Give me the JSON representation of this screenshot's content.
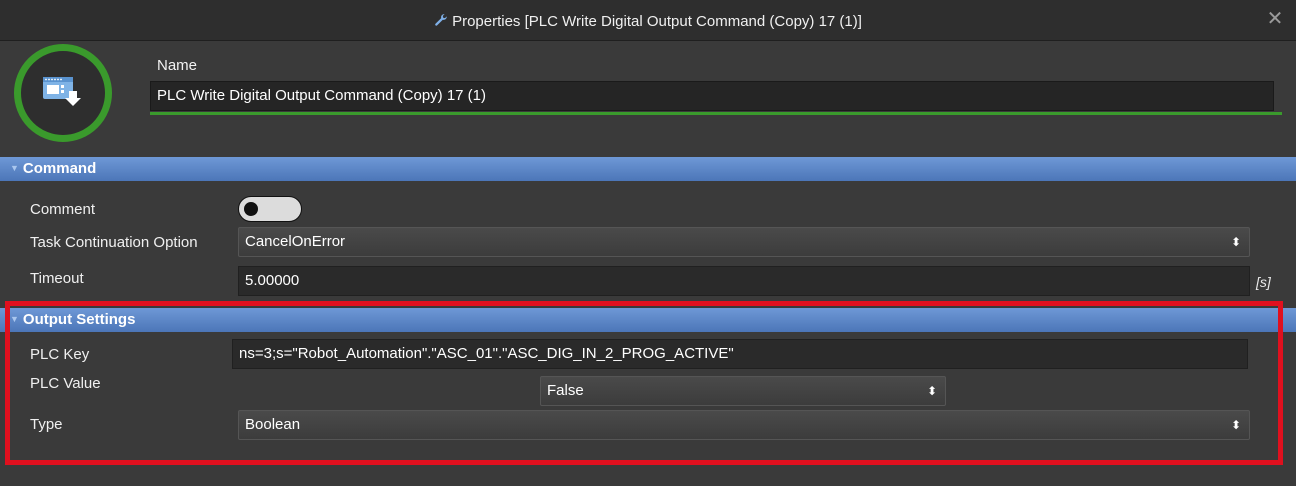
{
  "window": {
    "title": "Properties [PLC Write Digital Output Command (Copy) 17 (1)]",
    "title_icon": "wrench-icon",
    "close_icon": "close-icon"
  },
  "header": {
    "icon": "plc-output-icon",
    "icon_ring_color": "#3a9a2c",
    "name_label": "Name",
    "name_value": "PLC Write Digital Output Command (Copy) 17 (1)"
  },
  "command": {
    "section_title": "Command",
    "comment_label": "Comment",
    "comment_toggle_on": false,
    "task_continuation_label": "Task Continuation Option",
    "task_continuation_value": "CancelOnError",
    "timeout_label": "Timeout",
    "timeout_value": "5.00000",
    "timeout_unit": "[s]"
  },
  "output_settings": {
    "section_title": "Output Settings",
    "plc_key_label": "PLC Key",
    "plc_key_value": "ns=3;s=\"Robot_Automation\".\"ASC_01\".\"ASC_DIG_IN_2_PROG_ACTIVE\"",
    "plc_value_label": "PLC Value",
    "plc_value_value": "False",
    "type_label": "Type",
    "type_value": "Boolean",
    "highlight_color": "#e0101e"
  },
  "colors": {
    "section_header": "#5b86c8",
    "accent_green": "#3a9a2c",
    "background": "#3a3a3a"
  }
}
